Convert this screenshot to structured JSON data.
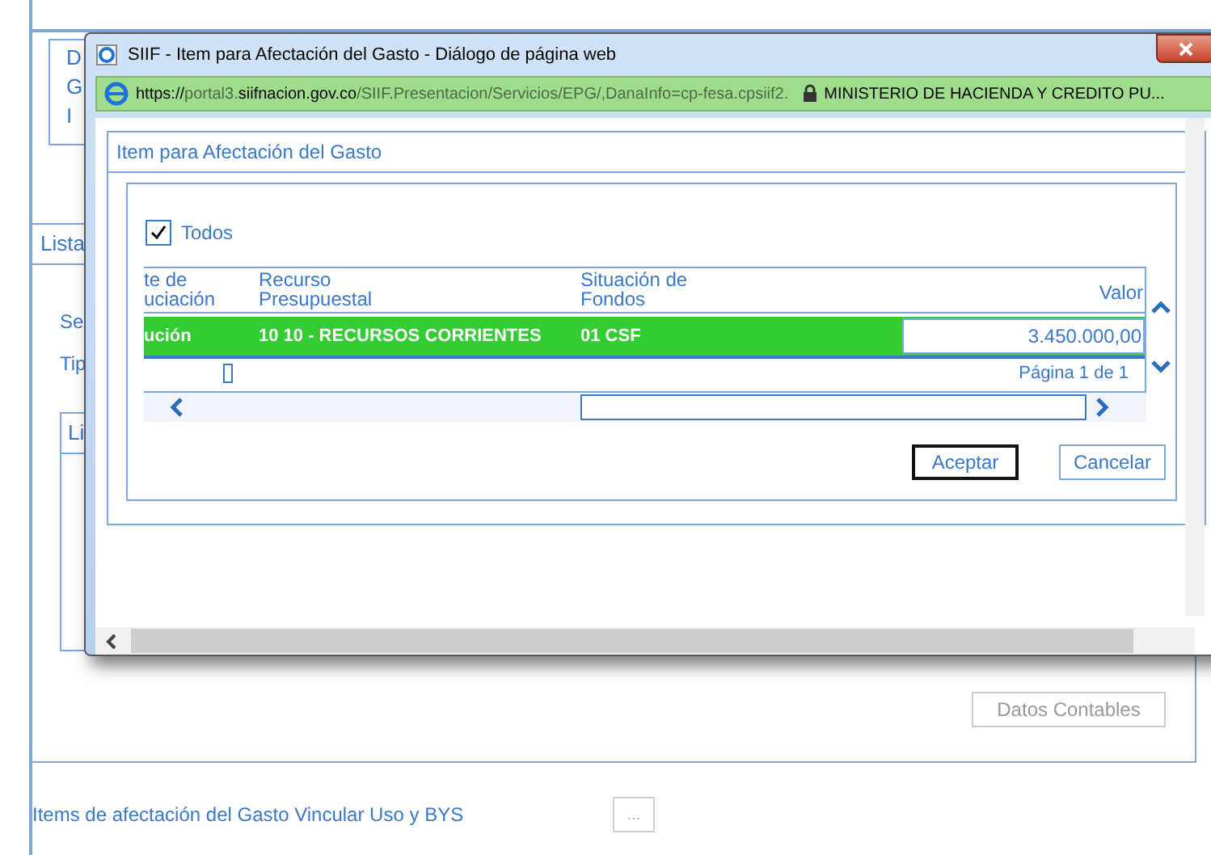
{
  "background": {
    "top_labels": [
      "D",
      "G",
      "I"
    ],
    "list_tab": "Lista",
    "field_labels": [
      "Se",
      "Tip"
    ],
    "inner_tab": "Li",
    "accounting_button": {
      "label": "Datos Contables",
      "disabled": true
    },
    "link_label": "Items de afectación del Gasto Vincular Uso y BYS",
    "ellipsis_button": {
      "label": "...",
      "disabled": true
    }
  },
  "dialog": {
    "title": "SIIF - Item para Afectación del Gasto - Diálogo de página web",
    "url_parts": [
      {
        "text": "https://",
        "dim": false
      },
      {
        "text": "portal3.",
        "dim": true
      },
      {
        "text": "siifnacion.gov.co",
        "dim": false
      },
      {
        "text": "/SIIF.Presentacion/Servicios/EPG/,DanaInfo=cp-fesa.cpsiif2.",
        "dim": true
      }
    ],
    "site_name": "MINISTERIO DE HACIENDA Y CREDITO PU...",
    "panel_title": "Item para Afectación del Gasto",
    "select_all": {
      "label": "Todos",
      "checked": true
    },
    "columns": [
      "te de\nuciación",
      "Recurso\nPresupuestal",
      "Situación de\nFondos",
      "Valor"
    ],
    "rows": [
      {
        "selected": true,
        "cells": [
          "ución",
          "10 10 - RECURSOS CORRIENTES",
          "01 CSF"
        ],
        "value": "3.450.000,00"
      }
    ],
    "pager": "Página 1 de 1",
    "buttons": [
      {
        "label": "Aceptar",
        "focused": true
      },
      {
        "label": "Cancelar",
        "focused": false
      }
    ]
  }
}
